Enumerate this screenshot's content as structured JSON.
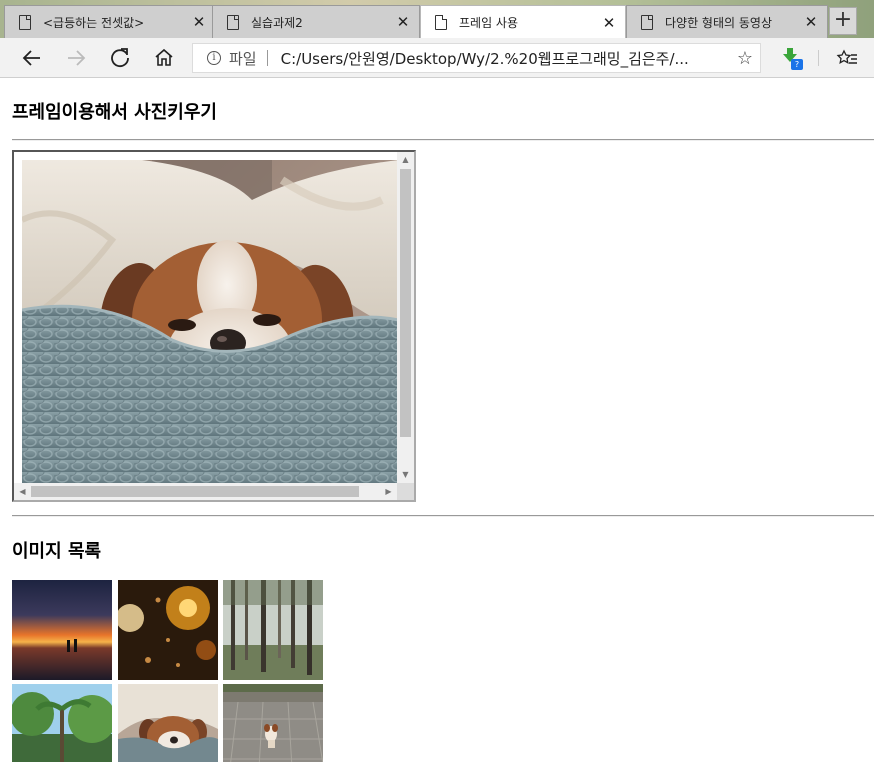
{
  "tabs": [
    {
      "title": "<급등하는 전셋값>",
      "active": false
    },
    {
      "title": "실습과제2",
      "active": false
    },
    {
      "title": "프레임 사용",
      "active": true
    },
    {
      "title": "다양한 형태의 동영상",
      "active": false
    }
  ],
  "address_bar": {
    "scheme_label": "파일",
    "url": "C:/Users/안원영/Desktop/Wy/2.%20웹프로그래밍_김은주/..."
  },
  "extension": {
    "badge": "?"
  },
  "page": {
    "heading_frame": "프레임이용해서 사진키우기",
    "heading_list": "이미지 목록"
  },
  "thumbnails": [
    {
      "subject": "sunset-beach"
    },
    {
      "subject": "rainy-window-bokeh"
    },
    {
      "subject": "misty-forest"
    },
    {
      "subject": "palm-trees"
    },
    {
      "subject": "puppy-on-blanket"
    },
    {
      "subject": "puppy-on-path"
    }
  ],
  "colors": {
    "tab_active": "#ffffff",
    "tab_inactive": "#cfcfcf",
    "navbar": "#f2f2f2",
    "extension_badge": "#1a73e8"
  }
}
